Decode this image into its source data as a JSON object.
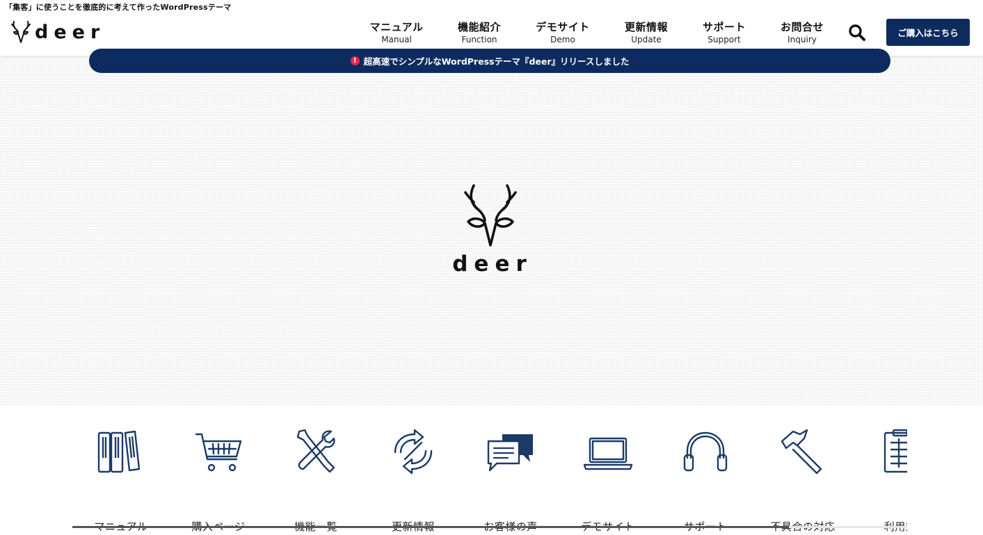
{
  "header": {
    "tagline": "「集客」に使うことを徹底的に考えて作ったWordPressテーマ",
    "logo_text": "deer",
    "nav": [
      {
        "jp": "マニュアル",
        "en": "Manual"
      },
      {
        "jp": "機能紹介",
        "en": "Function"
      },
      {
        "jp": "デモサイト",
        "en": "Demo"
      },
      {
        "jp": "更新情報",
        "en": "Update"
      },
      {
        "jp": "サポート",
        "en": "Support"
      },
      {
        "jp": "お問合せ",
        "en": "Inquiry"
      }
    ],
    "search_icon": "search-icon",
    "buy_button": "ご購入はこちら"
  },
  "notice": {
    "icon": "!",
    "text": "超高速でシンプルなWordPressテーマ『deer』リリースしました"
  },
  "hero": {
    "logo_text": "deer"
  },
  "menu": {
    "items": [
      {
        "label": "マニュアル",
        "icon": "books-icon"
      },
      {
        "label": "購入ページ",
        "icon": "cart-icon"
      },
      {
        "label": "機能一覧",
        "icon": "tools-icon"
      },
      {
        "label": "更新情報",
        "icon": "refresh-icon"
      },
      {
        "label": "お客様の声",
        "icon": "chat-icon"
      },
      {
        "label": "デモサイト",
        "icon": "laptop-icon"
      },
      {
        "label": "サポート",
        "icon": "headphones-icon"
      },
      {
        "label": "不具合の対応",
        "icon": "hammer-icon"
      },
      {
        "label": "利用規",
        "icon": "clipboard-icon"
      }
    ]
  },
  "colors": {
    "navy": "#0d2b5e",
    "alert_red": "#e8284b",
    "icon_stroke": "#1c3a66"
  }
}
